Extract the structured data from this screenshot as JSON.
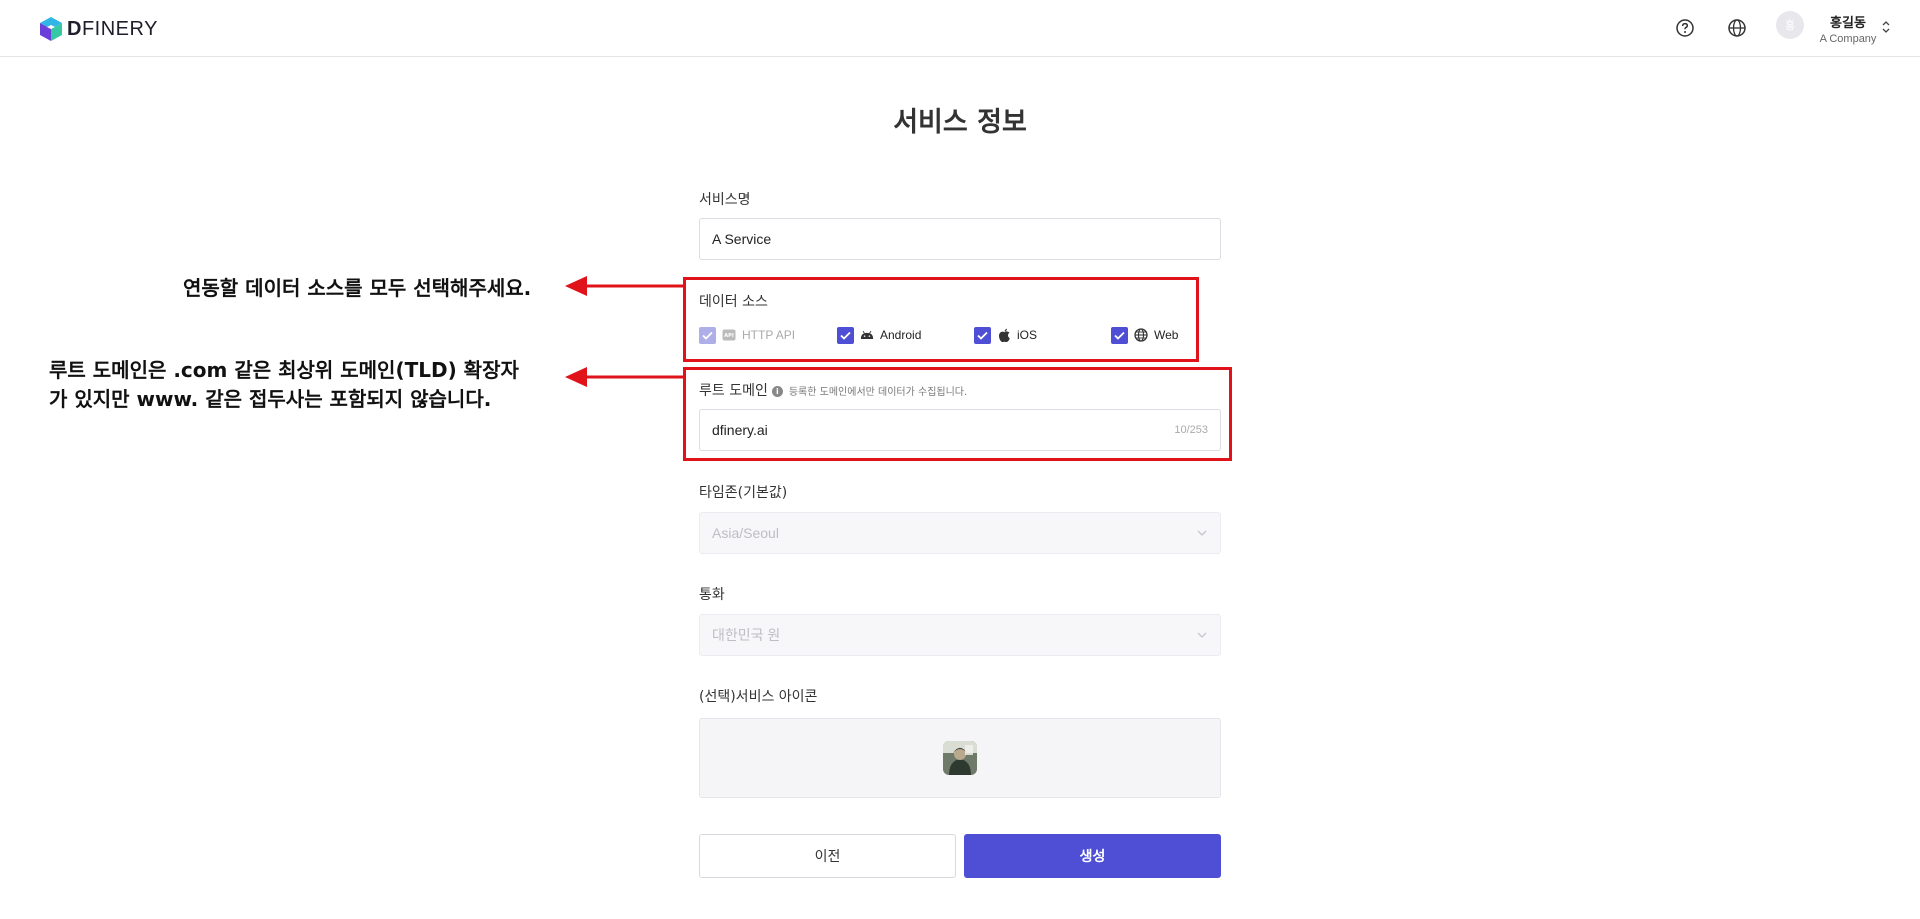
{
  "header": {
    "brand_first": "D",
    "brand_rest": "FINERY",
    "user_initial": "홍",
    "user_name": "홍길동",
    "user_company": "A Company"
  },
  "page": {
    "title": "서비스 정보"
  },
  "form": {
    "service_name": {
      "label": "서비스명",
      "value": "A Service"
    },
    "data_source": {
      "label": "데이터 소스",
      "options": [
        {
          "label": "HTTP API",
          "checked": true,
          "disabled": true,
          "icon": "api-icon"
        },
        {
          "label": "Android",
          "checked": true,
          "disabled": false,
          "icon": "android-icon"
        },
        {
          "label": "iOS",
          "checked": true,
          "disabled": false,
          "icon": "apple-icon"
        },
        {
          "label": "Web",
          "checked": true,
          "disabled": false,
          "icon": "globe-icon"
        }
      ]
    },
    "root_domain": {
      "label": "루트 도메인",
      "hint": "등록한 도메인에서만 데이터가 수집됩니다.",
      "value": "dfinery.ai",
      "counter": "10/253"
    },
    "timezone": {
      "label": "타임존(기본값)",
      "value": "Asia/Seoul"
    },
    "currency": {
      "label": "통화",
      "value": "대한민국 원"
    },
    "service_icon": {
      "label": "(선택)서비스 아이콘"
    },
    "prev_label": "이전",
    "create_label": "생성"
  },
  "annotations": {
    "data_source_note": "연동할 데이터 소스를 모두 선택해주세요.",
    "domain_note_line1": "루트 도메인은 .com 같은 최상위 도메인(TLD) 확장자",
    "domain_note_line2": "가 있지만 www. 같은 접두사는 포함되지 않습니다.",
    "color": "#e0131a"
  },
  "colors": {
    "accent": "#4f4fd6",
    "highlight": "#e0131a"
  }
}
